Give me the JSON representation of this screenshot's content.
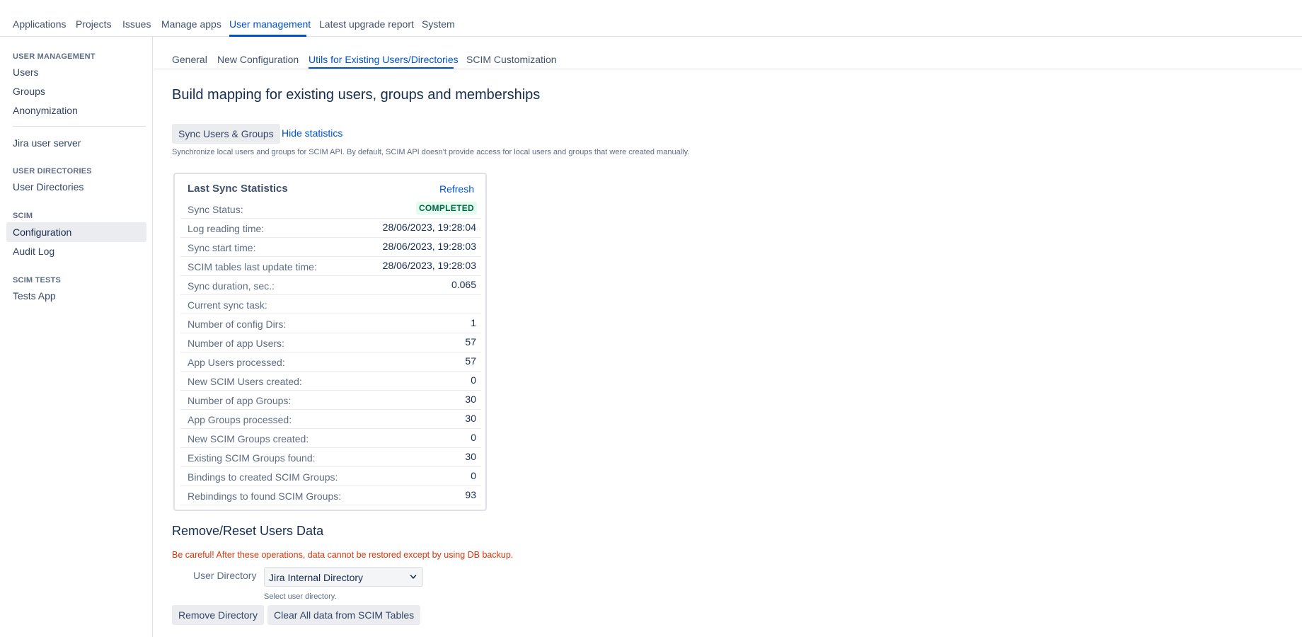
{
  "topnav": {
    "items": [
      "Applications",
      "Projects",
      "Issues",
      "Manage apps",
      "User management",
      "Latest upgrade report",
      "System"
    ],
    "active": "User management"
  },
  "sidebar": {
    "user_management_heading": "USER MANAGEMENT",
    "users": "Users",
    "groups": "Groups",
    "anonymization": "Anonymization",
    "jira_user_server": "Jira user server",
    "user_directories_heading": "USER DIRECTORIES",
    "user_directories": "User Directories",
    "scim_heading": "SCIM",
    "configuration": "Configuration",
    "audit_log": "Audit Log",
    "scim_tests_heading": "SCIM TESTS",
    "tests_app": "Tests App"
  },
  "tabs": {
    "items": [
      "General",
      "New Configuration",
      "Utils for Existing Users/Directories",
      "SCIM Customization"
    ],
    "active": "Utils for Existing Users/Directories"
  },
  "page": {
    "title": "Build mapping for existing users, groups and memberships",
    "sync_button": "Sync Users & Groups",
    "hide_stats_link": "Hide statistics",
    "sync_help": "Synchronize local users and groups for SCIM API. By default, SCIM API doesn't provide access for local users and groups that were created manually."
  },
  "stats": {
    "title": "Last Sync Statistics",
    "refresh": "Refresh",
    "status_label": "Sync Status:",
    "status_value": "COMPLETED",
    "status_color": "#006644",
    "rows": [
      {
        "label": "Log reading time:",
        "value": "28/06/2023, 19:28:04"
      },
      {
        "label": "Sync start time:",
        "value": "28/06/2023, 19:28:03"
      },
      {
        "label": "SCIM tables last update time:",
        "value": "28/06/2023, 19:28:03"
      },
      {
        "label": "Sync duration, sec.:",
        "value": "0.065"
      },
      {
        "label": "Current sync task:",
        "value": ""
      },
      {
        "label": "Number of config Dirs:",
        "value": "1"
      },
      {
        "label": "Number of app Users:",
        "value": "57"
      },
      {
        "label": "App Users processed:",
        "value": "57"
      },
      {
        "label": "New SCIM Users created:",
        "value": "0"
      },
      {
        "label": "Number of app Groups:",
        "value": "30"
      },
      {
        "label": "App Groups processed:",
        "value": "30"
      },
      {
        "label": "New SCIM Groups created:",
        "value": "0"
      },
      {
        "label": "Existing SCIM Groups found:",
        "value": "30"
      },
      {
        "label": "Bindings to created SCIM Groups:",
        "value": "0"
      },
      {
        "label": "Rebindings to found SCIM Groups:",
        "value": "93"
      }
    ]
  },
  "remove": {
    "title": "Remove/Reset Users Data",
    "warning": "Be careful! After these operations, data cannot be restored except by using DB backup.",
    "directory_label": "User Directory",
    "directory_value": "Jira Internal Directory",
    "directory_help": "Select user directory.",
    "remove_button": "Remove Directory",
    "clear_button": "Clear All data from SCIM Tables"
  },
  "colors": {
    "accent": "#0052cc",
    "warning": "#de350b",
    "success_bg": "#e3fcef"
  }
}
